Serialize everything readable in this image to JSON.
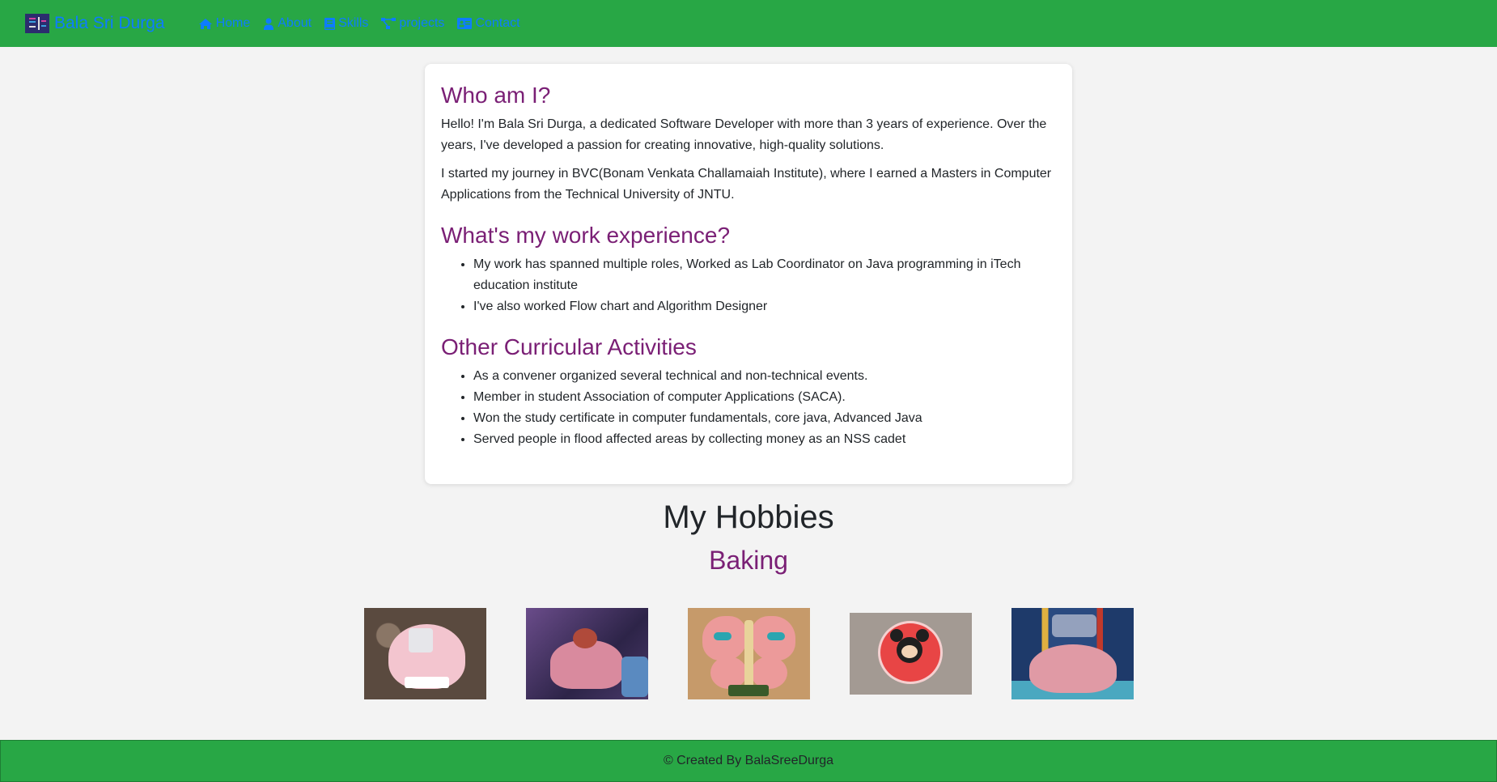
{
  "nav": {
    "brand": "Bala Sri Durga",
    "items": [
      {
        "label": "Home",
        "icon": "home-icon"
      },
      {
        "label": "About",
        "icon": "user-icon"
      },
      {
        "label": "Skills",
        "icon": "book-icon"
      },
      {
        "label": "projects",
        "icon": "project-diagram-icon"
      },
      {
        "label": "Contact",
        "icon": "address-card-icon"
      }
    ]
  },
  "about": {
    "who_title": "Who am I?",
    "who_p1": "Hello! I'm Bala Sri Durga, a dedicated Software Developer with more than 3 years of experience. Over the years, I've developed a passion for creating innovative, high-quality solutions.",
    "who_p2": "I started my journey in BVC(Bonam Venkata Challamaiah Institute), where I earned a Masters in Computer Applications from the Technical University of JNTU.",
    "work_title": "What's my work experience?",
    "work_items": [
      "My work has spanned multiple roles, Worked as Lab Coordinator on Java programming in iTech education institute",
      "I've also worked Flow chart and Algorithm Designer"
    ],
    "activities_title": "Other Curricular Activities",
    "activities_items": [
      "As a convener organized several technical and non-technical events.",
      "Member in student Association of computer Applications (SACA).",
      "Won the study certificate in computer fundamentals, core java, Advanced Java",
      "Served people in flood affected areas by collecting money as an NSS cadet"
    ]
  },
  "hobbies": {
    "title": "My Hobbies",
    "subtitle": "Baking",
    "photos": [
      {
        "name": "cake-photo-1",
        "colors": [
          "#6b5a4e",
          "#e9a7b5",
          "#ffffff"
        ]
      },
      {
        "name": "cake-photo-2",
        "colors": [
          "#3b2c5a",
          "#d98a9e",
          "#7a9bc7"
        ]
      },
      {
        "name": "cake-photo-3",
        "colors": [
          "#b07a4a",
          "#e98a8a",
          "#38a8b0"
        ]
      },
      {
        "name": "cake-photo-4",
        "colors": [
          "#a49b95",
          "#e23a3a",
          "#2b2b2b"
        ]
      },
      {
        "name": "cake-photo-5",
        "colors": [
          "#2a4a78",
          "#dd8d95",
          "#4da6b8"
        ]
      }
    ]
  },
  "footer": {
    "text": "© Created By BalaSreeDurga"
  },
  "colors": {
    "navbar": "#28a745",
    "link": "#0d7cff",
    "heading": "#7a1f75"
  }
}
